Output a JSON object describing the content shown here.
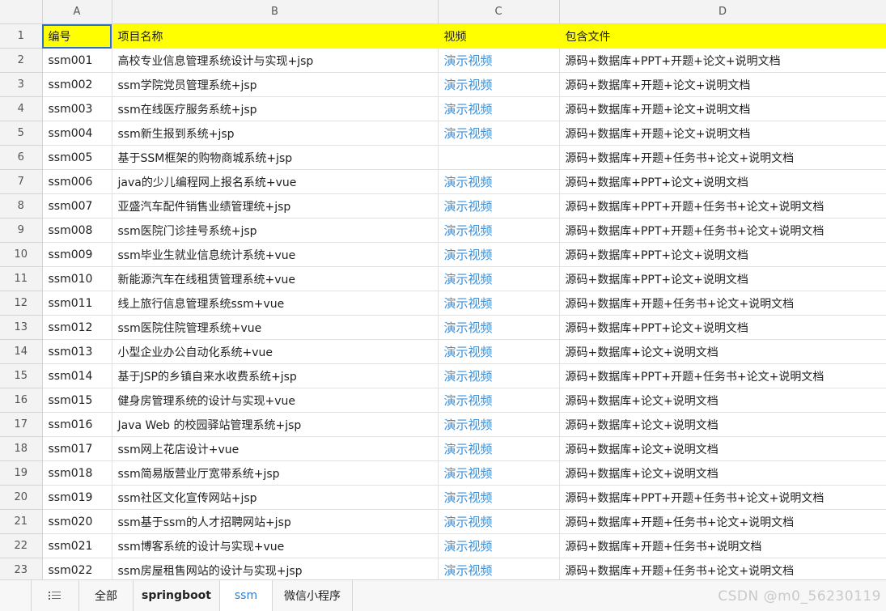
{
  "columns": [
    "A",
    "B",
    "C",
    "D"
  ],
  "header_row": {
    "row_number": "1",
    "cells": [
      "编号",
      "项目名称",
      "视频",
      "包含文件"
    ]
  },
  "rows": [
    {
      "n": "2",
      "id": "ssm001",
      "name": "高校专业信息管理系统设计与实现+jsp",
      "video": "演示视频",
      "files": "源码+数据库+PPT+开题+论文+说明文档"
    },
    {
      "n": "3",
      "id": "ssm002",
      "name": "ssm学院党员管理系统+jsp",
      "video": "演示视频",
      "files": "源码+数据库+开题+论文+说明文档"
    },
    {
      "n": "4",
      "id": "ssm003",
      "name": "ssm在线医疗服务系统+jsp",
      "video": "演示视频",
      "files": "源码+数据库+开题+论文+说明文档"
    },
    {
      "n": "5",
      "id": "ssm004",
      "name": "ssm新生报到系统+jsp",
      "video": "演示视频",
      "files": "源码+数据库+开题+论文+说明文档"
    },
    {
      "n": "6",
      "id": "ssm005",
      "name": "基于SSM框架的购物商城系统+jsp",
      "video": "",
      "files": "源码+数据库+开题+任务书+论文+说明文档"
    },
    {
      "n": "7",
      "id": "ssm006",
      "name": "java的少儿编程网上报名系统+vue",
      "video": "演示视频",
      "files": "源码+数据库+PPT+论文+说明文档"
    },
    {
      "n": "8",
      "id": "ssm007",
      "name": "亚盛汽车配件销售业绩管理统+jsp",
      "video": "演示视频",
      "files": "源码+数据库+PPT+开题+任务书+论文+说明文档"
    },
    {
      "n": "9",
      "id": "ssm008",
      "name": "ssm医院门诊挂号系统+jsp",
      "video": "演示视频",
      "files": "源码+数据库+PPT+开题+任务书+论文+说明文档"
    },
    {
      "n": "10",
      "id": "ssm009",
      "name": "ssm毕业生就业信息统计系统+vue",
      "video": "演示视频",
      "files": "源码+数据库+PPT+论文+说明文档"
    },
    {
      "n": "11",
      "id": "ssm010",
      "name": "新能源汽车在线租赁管理系统+vue",
      "video": "演示视频",
      "files": "源码+数据库+PPT+论文+说明文档"
    },
    {
      "n": "12",
      "id": "ssm011",
      "name": "线上旅行信息管理系统ssm+vue",
      "video": "演示视频",
      "files": "源码+数据库+开题+任务书+论文+说明文档"
    },
    {
      "n": "13",
      "id": "ssm012",
      "name": "ssm医院住院管理系统+vue",
      "video": "演示视频",
      "files": "源码+数据库+PPT+论文+说明文档"
    },
    {
      "n": "14",
      "id": "ssm013",
      "name": "小型企业办公自动化系统+vue",
      "video": "演示视频",
      "files": "源码+数据库+论文+说明文档"
    },
    {
      "n": "15",
      "id": "ssm014",
      "name": "基于JSP的乡镇自来水收费系统+jsp",
      "video": "演示视频",
      "files": "源码+数据库+PPT+开题+任务书+论文+说明文档"
    },
    {
      "n": "16",
      "id": "ssm015",
      "name": "健身房管理系统的设计与实现+vue",
      "video": "演示视频",
      "files": "源码+数据库+论文+说明文档"
    },
    {
      "n": "17",
      "id": "ssm016",
      "name": "Java Web 的校园驿站管理系统+jsp",
      "video": "演示视频",
      "files": "源码+数据库+论文+说明文档"
    },
    {
      "n": "18",
      "id": "ssm017",
      "name": "ssm网上花店设计+vue",
      "video": "演示视频",
      "files": "源码+数据库+论文+说明文档"
    },
    {
      "n": "19",
      "id": "ssm018",
      "name": "ssm简易版营业厅宽带系统+jsp",
      "video": "演示视频",
      "files": "源码+数据库+论文+说明文档"
    },
    {
      "n": "20",
      "id": "ssm019",
      "name": "ssm社区文化宣传网站+jsp",
      "video": "演示视频",
      "files": "源码+数据库+PPT+开题+任务书+论文+说明文档"
    },
    {
      "n": "21",
      "id": "ssm020",
      "name": "ssm基于ssm的人才招聘网站+jsp",
      "video": "演示视频",
      "files": "源码+数据库+开题+任务书+论文+说明文档"
    },
    {
      "n": "22",
      "id": "ssm021",
      "name": "ssm博客系统的设计与实现+vue",
      "video": "演示视频",
      "files": "源码+数据库+开题+任务书+说明文档"
    },
    {
      "n": "23",
      "id": "ssm022",
      "name": "ssm房屋租售网站的设计与实现+jsp",
      "video": "演示视频",
      "files": "源码+数据库+开题+任务书+论文+说明文档"
    }
  ],
  "tabs": [
    {
      "label": "全部",
      "active": false
    },
    {
      "label": "springboot",
      "active": false
    },
    {
      "label": "ssm",
      "active": true
    },
    {
      "label": "微信小程序",
      "active": false
    }
  ],
  "menu_icon": "sheet-list-icon",
  "watermark": "CSDN @m0_56230119",
  "colors": {
    "header_fill": "#ffff00",
    "link": "#3a8fd9",
    "selection": "#2f6fc4",
    "active_tab": "#2f7fcf"
  }
}
